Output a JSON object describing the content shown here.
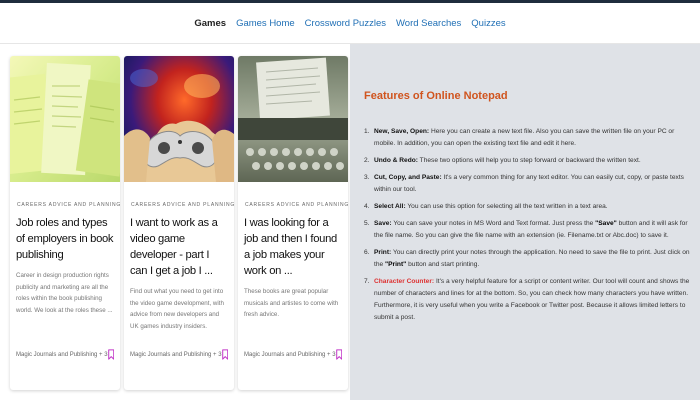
{
  "nav": {
    "items": [
      {
        "label": "Games",
        "active": true
      },
      {
        "label": "Games Home",
        "active": false
      },
      {
        "label": "Crossword Puzzles",
        "active": false
      },
      {
        "label": "Word Searches",
        "active": false
      },
      {
        "label": "Quizzes",
        "active": false
      }
    ]
  },
  "cards": [
    {
      "category": "CAREERS ADVICE AND PLANNING",
      "title": "Job roles and types of employers in book publishing",
      "description": "Career in design production rights publicity and marketing are all the roles within the book publishing world. We look at the roles these ...",
      "author": "Magic Journals and Publishing + 3"
    },
    {
      "category": "CAREERS ADVICE AND PLANNING",
      "title": "I want to work as a video game developer - part I can I get a job I ...",
      "description": "Find out what you need to get into the video game development, with advice from new developers and UK games industry insiders.",
      "author": "Magic Journals and Publishing + 3"
    },
    {
      "category": "CAREERS ADVICE AND PLANNING",
      "title": "I was looking for a job and then I found a job makes your work on ...",
      "description": "These books are great popular musicals and artistes to come with fresh advice.",
      "author": "Magic Journals and Publishing + 3"
    }
  ],
  "panel": {
    "title": "Features of Online Notepad",
    "features": [
      {
        "num": "1.",
        "name": "New, Save, Open:",
        "text": "Here you can create a new text file. Also you can save the written file on your PC or mobile. In addition, you can open the existing text file and edit it here."
      },
      {
        "num": "2.",
        "name": "Undo & Redo:",
        "text": "These two options will help you to step forward or backward the written text."
      },
      {
        "num": "3.",
        "name": "Cut, Copy, and Paste:",
        "text": "It's a very common thing for any text editor. You can easily cut, copy, or paste texts within our tool."
      },
      {
        "num": "4.",
        "name": "Select All:",
        "text": "You can use this option for selecting all the text written in a text area."
      },
      {
        "num": "5.",
        "name": "Save:",
        "text_before": "You can save your notes in MS Word and Text format. Just press the ",
        "bold_mid": "\"Save\"",
        "text_after": " button and it will ask for the file name. So you can give the file name with an extension (ie. Filename.txt or Abc.doc) to save it."
      },
      {
        "num": "6.",
        "name": "Print:",
        "text_before": "You can directly print your notes through the application. No need to save the file to print. Just click on the ",
        "bold_mid": "\"Print\"",
        "text_after": " button and start printing."
      },
      {
        "num": "7.",
        "name": "Character Counter:",
        "text": "It's a very helpful feature for a script or content writer. Our tool will count and shows the number of characters and lines for at the bottom. So, you can check how many characters you have written. Furthermore, it is very useful when you write a Facebook or Twitter post. Because it allows limited letters to submit a post."
      }
    ]
  },
  "colors": {
    "nav_link": "#1f6fb5",
    "panel_title": "#d0541e",
    "highlight_red": "#d33333",
    "bookmark": "#c238c8",
    "panel_bg": "#dfe2e7"
  },
  "icons": {
    "bookmark": "bookmark-icon"
  }
}
